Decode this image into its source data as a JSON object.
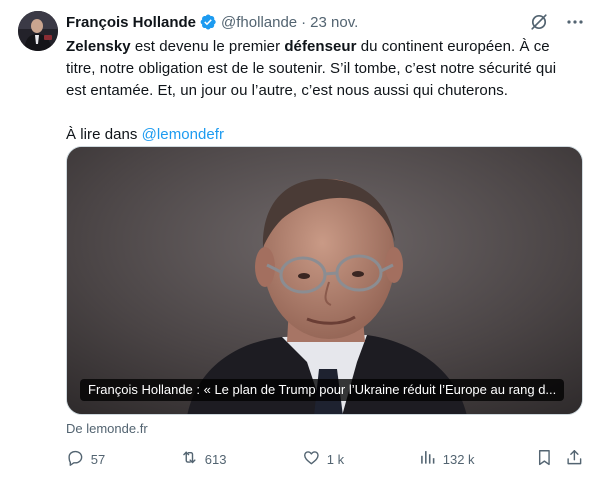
{
  "author": {
    "name": "François Hollande",
    "handle": "@fhollande",
    "separator": "·",
    "date": "23 nov."
  },
  "tweet": {
    "line1_bold1": "Zelensky",
    "line1_mid": " est devenu le premier ",
    "line1_bold2": "défenseur",
    "line1_end": " du continent européen. À ce",
    "line2": "titre, notre obligation est de le soutenir. S’il tombe, c’est notre sécurité qui",
    "line3": "est entamée. Et, un jour ou l’autre, c’est nous aussi qui chuterons.",
    "line4_prefix": "À lire dans ",
    "line4_link": "@lemondefr"
  },
  "card": {
    "caption": "François Hollande : « Le plan de Trump pour l’Ukraine réduit l’Europe au rang d..."
  },
  "source": "De lemonde.fr",
  "actions": {
    "replies": "57",
    "reposts": "613",
    "likes": "1 k",
    "views": "132 k"
  },
  "icons": {
    "verified": "verified-badge-icon",
    "grok": "grok-icon",
    "more": "more-icon",
    "reply": "reply-icon",
    "repost": "repost-icon",
    "like": "like-icon",
    "views": "views-icon",
    "bookmark": "bookmark-icon",
    "share": "share-icon"
  },
  "colors": {
    "accent": "#1d9bf0",
    "text": "#0f1419",
    "muted": "#536471"
  }
}
